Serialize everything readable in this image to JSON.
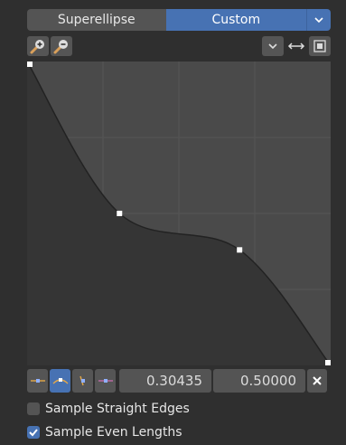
{
  "mode": {
    "options": [
      "Superellipse",
      "Custom"
    ],
    "selected": "Custom"
  },
  "toolbar": {
    "zoom_in_icon": "zoom-in-icon",
    "zoom_out_icon": "zoom-out-icon",
    "view_dropdown_icon": "chevron-down-icon",
    "flip_icon": "flip-horizontal-icon",
    "clip_icon": "clip-toggle-icon"
  },
  "curve": {
    "points": [
      {
        "x": 0.0,
        "y": 1.0
      },
      {
        "x": 0.30435,
        "y": 0.5
      },
      {
        "x": 0.7,
        "y": 0.38
      },
      {
        "x": 1.0,
        "y": 0.0
      }
    ],
    "selected_index": 1
  },
  "point_editor": {
    "x_value": "0.30435",
    "y_value": "0.50000",
    "handle_types": [
      "vector",
      "auto",
      "auto-clamped",
      "free"
    ],
    "active_handle": "auto"
  },
  "options": {
    "sample_straight_edges": {
      "label": "Sample Straight Edges",
      "checked": false
    },
    "sample_even_lengths": {
      "label": "Sample Even Lengths",
      "checked": true
    }
  },
  "colors": {
    "accent": "#4772b3",
    "panel": "#2f2f2f",
    "curve_bg": "#4a4a4a",
    "curve_fill": "#353535"
  }
}
